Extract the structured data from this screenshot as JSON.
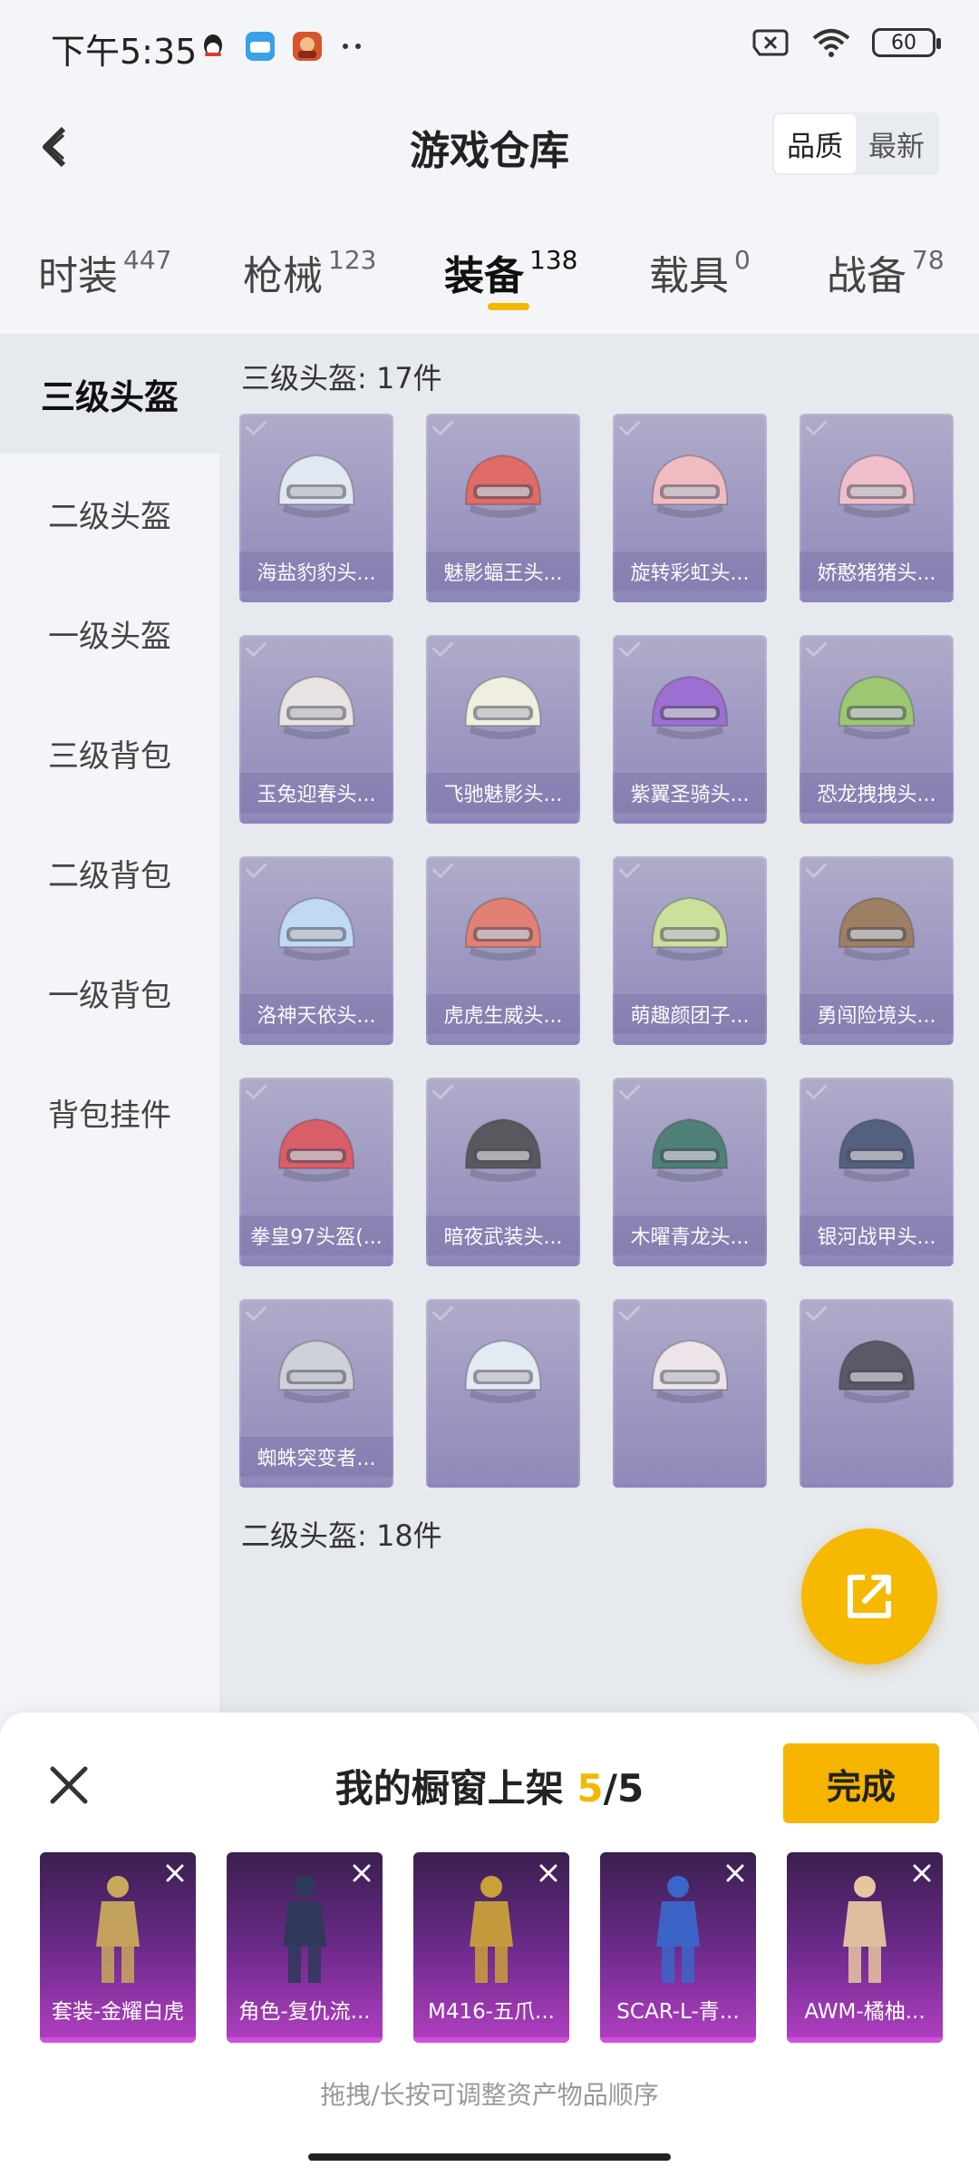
{
  "status": {
    "time": "下午5:35",
    "battery": "60"
  },
  "header": {
    "title": "游戏仓库",
    "sort_quality": "品质",
    "sort_latest": "最新"
  },
  "tabs": [
    {
      "label": "时装",
      "count": "447"
    },
    {
      "label": "枪械",
      "count": "123"
    },
    {
      "label": "装备",
      "count": "138"
    },
    {
      "label": "载具",
      "count": "0"
    },
    {
      "label": "战备",
      "count": "78"
    }
  ],
  "sidebar": [
    "三级头盔",
    "二级头盔",
    "一级头盔",
    "三级背包",
    "二级背包",
    "一级背包",
    "背包挂件"
  ],
  "sections": [
    {
      "title": "三级头盔: 17件"
    },
    {
      "title": "二级头盔: 18件"
    }
  ],
  "items": [
    {
      "label": "海盐豹豹头...",
      "color": "#dfe8f2"
    },
    {
      "label": "魅影蝠王头...",
      "color": "#e0504a"
    },
    {
      "label": "旋转彩虹头...",
      "color": "#f4b3b8"
    },
    {
      "label": "娇憨猪猪头...",
      "color": "#f3b6c4"
    },
    {
      "label": "玉兔迎春头...",
      "color": "#e9e2e0"
    },
    {
      "label": "飞驰魅影头...",
      "color": "#f2f0dc"
    },
    {
      "label": "紫翼圣骑头...",
      "color": "#8f55cc"
    },
    {
      "label": "恐龙拽拽头...",
      "color": "#8fc05a"
    },
    {
      "label": "洛神天依头...",
      "color": "#b9d6f4"
    },
    {
      "label": "虎虎生威头...",
      "color": "#e06b5a"
    },
    {
      "label": "萌趣颜团子...",
      "color": "#c6e08a"
    },
    {
      "label": "勇闯险境头...",
      "color": "#8d6a45"
    },
    {
      "label": "拳皇97头盔(...",
      "color": "#d8404a"
    },
    {
      "label": "暗夜武装头...",
      "color": "#3a3a3f"
    },
    {
      "label": "木曜青龙头...",
      "color": "#2e6a5e"
    },
    {
      "label": "银河战甲头...",
      "color": "#334466"
    },
    {
      "label": "蜘蛛突变者...",
      "color": "#c9ccd2"
    },
    {
      "label": "",
      "color": "#e2ebf3"
    },
    {
      "label": "",
      "color": "#efe4e8"
    },
    {
      "label": "",
      "color": "#3b3a4a"
    }
  ],
  "sheet": {
    "title_prefix": "我的橱窗上架 ",
    "current": "5",
    "total": "/5",
    "done": "完成",
    "hint": "拖拽/长按可调整资产物品顺序",
    "items": [
      {
        "label": "套装-金耀白虎",
        "color": "#c8a85a"
      },
      {
        "label": "角色-复仇流...",
        "color": "#2d3a5a"
      },
      {
        "label": "M416-五爪...",
        "color": "#c9a03a"
      },
      {
        "label": "SCAR-L-青...",
        "color": "#3a66c9"
      },
      {
        "label": "AWM-橘柚...",
        "color": "#e6c6a0"
      }
    ]
  }
}
